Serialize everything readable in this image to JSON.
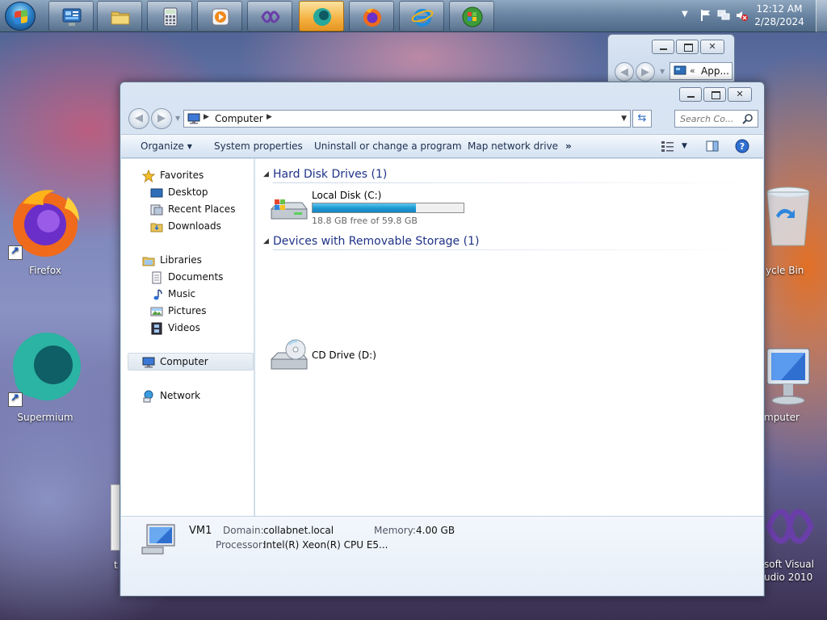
{
  "taskbar": {
    "clock_time": "12:12 AM",
    "clock_date": "2/28/2024"
  },
  "desktop": {
    "icons": {
      "firefox": "Firefox",
      "supermium": "Supermium",
      "recycle_bin": "ycle Bin",
      "computer": "mputer",
      "visual_studio_line1": "soft Visual",
      "visual_studio_line2": "udio 2010",
      "partial_left": "t"
    }
  },
  "back_window": {
    "address": "App..."
  },
  "explorer": {
    "address": {
      "crumb": "Computer"
    },
    "search": {
      "placeholder": "Search Co..."
    },
    "toolbar": {
      "organize": "Organize",
      "system_properties": "System properties",
      "uninstall": "Uninstall or change a program",
      "map_drive": "Map network drive",
      "more": "»"
    },
    "nav": {
      "favorites": "Favorites",
      "desktop": "Desktop",
      "recent_places": "Recent Places",
      "downloads": "Downloads",
      "libraries": "Libraries",
      "documents": "Documents",
      "music": "Music",
      "pictures": "Pictures",
      "videos": "Videos",
      "computer": "Computer",
      "network": "Network"
    },
    "groups": {
      "hdd_title": "Hard Disk Drives (1)",
      "removable_title": "Devices with Removable Storage (1)"
    },
    "drives": {
      "local_disk_name": "Local Disk (C:)",
      "local_disk_free": "18.8 GB free of 59.8 GB",
      "local_disk_used_fraction": 0.686,
      "cd_drive_name": "CD Drive (D:)"
    },
    "details": {
      "computer_name": "VM1",
      "domain_label": "Domain:",
      "domain_value": "collabnet.local",
      "memory_label": "Memory:",
      "memory_value": "4.00 GB",
      "processor_label": "Processor:",
      "processor_value": "Intel(R) Xeon(R) CPU E5..."
    }
  },
  "colors": {
    "group_title": "#1e3287",
    "progress_fill": "#1f9bd4",
    "taskbar_active": "#f5b040"
  }
}
